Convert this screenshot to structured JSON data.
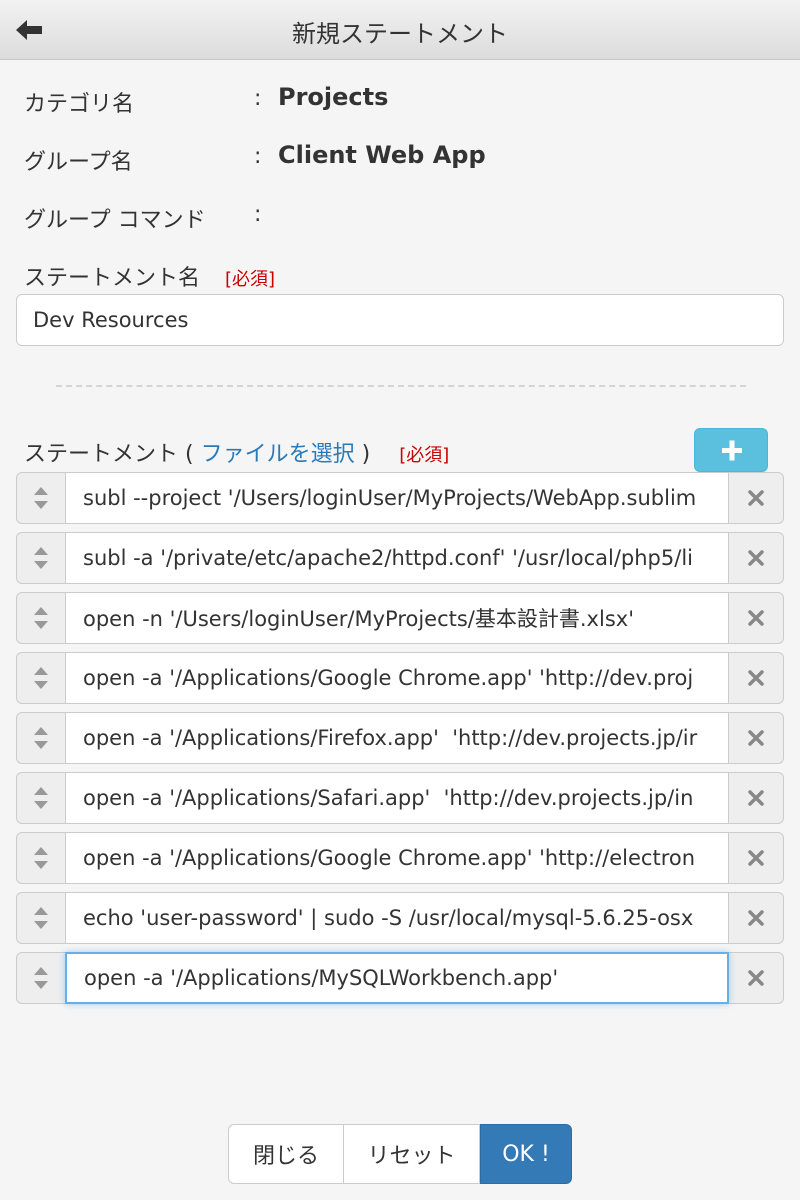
{
  "window": {
    "title": "新規ステートメント"
  },
  "info": {
    "category_label": "カテゴリ名",
    "category_value": "Projects",
    "group_label": "グループ名",
    "group_value": "Client Web App",
    "group_command_label": "グループ コマンド",
    "group_command_value": "",
    "colon": ":"
  },
  "statement_name": {
    "label": "ステートメント名",
    "required": "[必須]",
    "value": "Dev Resources"
  },
  "statements": {
    "label": "ステートメント",
    "paren_open": "(",
    "file_link": "ファイルを選択",
    "paren_close": ")",
    "required": "[必須]",
    "items": [
      "subl --project '/Users/loginUser/MyProjects/WebApp.sublim",
      "subl -a '/private/etc/apache2/httpd.conf' '/usr/local/php5/li",
      "open -n '/Users/loginUser/MyProjects/基本設計書.xlsx'",
      "open -a '/Applications/Google Chrome.app' 'http://dev.proj",
      "open -a '/Applications/Firefox.app'  'http://dev.projects.jp/ir",
      "open -a '/Applications/Safari.app'  'http://dev.projects.jp/in",
      "open -a '/Applications/Google Chrome.app' 'http://electron",
      "echo 'user-password' | sudo -S /usr/local/mysql-5.6.25-osx",
      "open -a '/Applications/MySQLWorkbench.app'"
    ]
  },
  "footer": {
    "close": "閉じる",
    "reset": "リセット",
    "ok": "OK !"
  },
  "icons": {
    "back": "back-arrow-icon",
    "add": "plus-icon",
    "handle": "sort-handle-icon",
    "remove": "close-x-icon"
  },
  "colors": {
    "accent": "#337ab7",
    "info": "#5bc0de",
    "required": "#cc0000",
    "link": "#2a7ab8"
  }
}
